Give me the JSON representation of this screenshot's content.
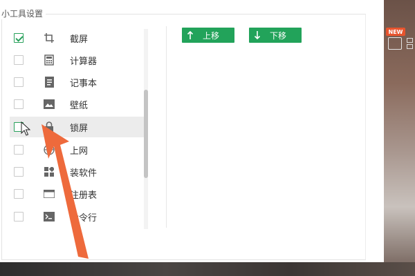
{
  "group_title": "小工具设置",
  "tools": [
    {
      "label": "截屏",
      "icon": "crop-icon",
      "checked": true
    },
    {
      "label": "计算器",
      "icon": "calculator-icon",
      "checked": false
    },
    {
      "label": "记事本",
      "icon": "notepad-icon",
      "checked": false
    },
    {
      "label": "壁纸",
      "icon": "image-icon",
      "checked": false
    },
    {
      "label": "锁屏",
      "icon": "lock-screen-icon",
      "checked": false
    },
    {
      "label": "上网",
      "icon": "globe-icon",
      "checked": false
    },
    {
      "label": "装软件",
      "icon": "apps-icon",
      "checked": false
    },
    {
      "label": "注册表",
      "icon": "registry-icon",
      "checked": false
    },
    {
      "label": "命令行",
      "icon": "terminal-icon",
      "checked": false
    }
  ],
  "buttons": {
    "move_up": "上移",
    "move_down": "下移"
  },
  "new_badge": "NEW",
  "colors": {
    "accent": "#22a35a",
    "annotation_arrow": "#ee6a3c"
  }
}
